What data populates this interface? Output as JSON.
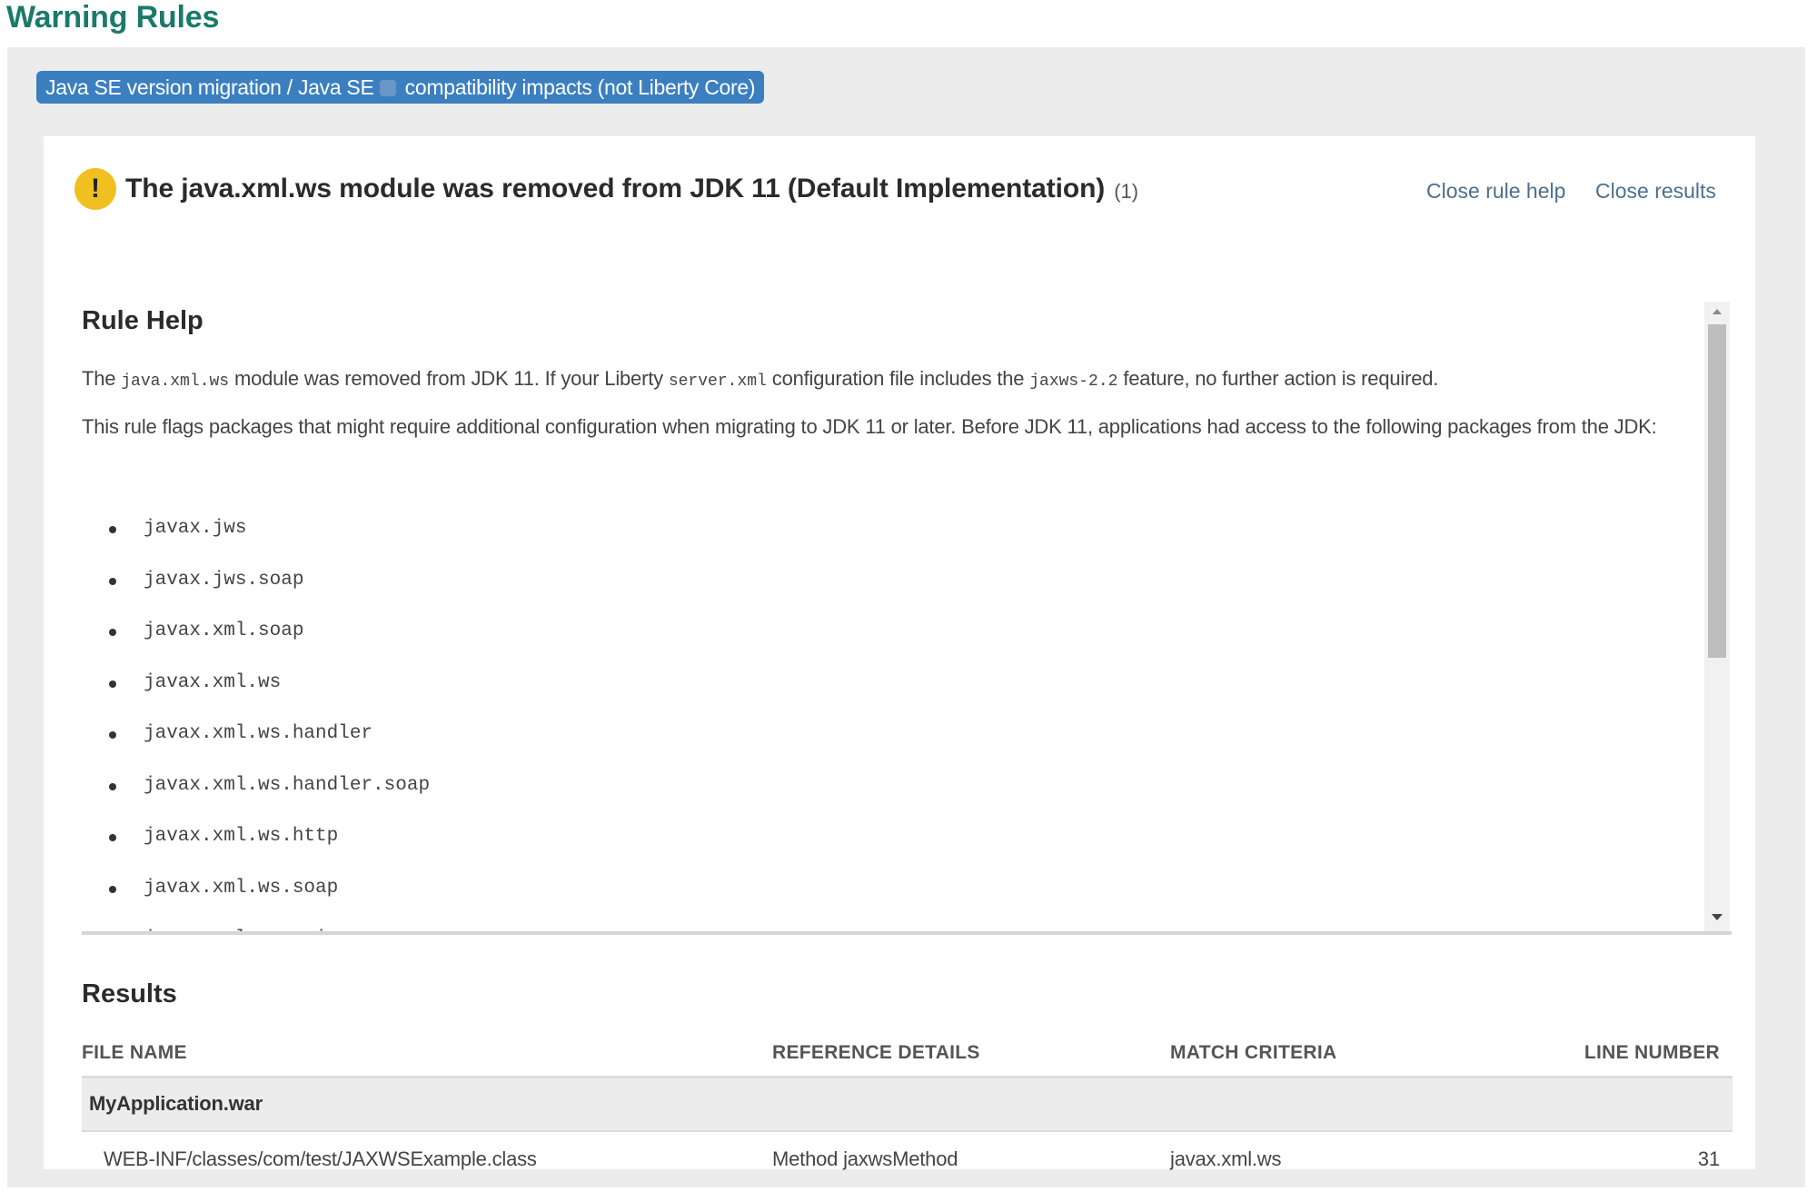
{
  "page": {
    "title": "Warning Rules"
  },
  "category": {
    "label_prefix": "Java SE version migration / Java SE ",
    "label_suffix": " compatibility impacts (not Liberty Core)"
  },
  "rule": {
    "severity_icon": "warning-icon",
    "severity_glyph": "!",
    "title": "The java.xml.ws module was removed from JDK 11 (Default Implementation)",
    "count": "(1)",
    "links": {
      "close_rule_help": "Close rule help",
      "close_results": "Close results"
    }
  },
  "rule_help": {
    "heading": "Rule Help",
    "paragraph1": {
      "t1": "The ",
      "c1": "java.xml.ws",
      "t2": " module was removed from JDK 11. If your Liberty ",
      "c2": "server.xml",
      "t3": " configuration file includes the ",
      "c3": "jaxws-2.2",
      "t4": " feature, no further action is required."
    },
    "paragraph2": "This rule flags packages that might require additional configuration when migrating to JDK 11 or later. Before JDK 11, applications had access to the following packages from the JDK:",
    "packages": [
      "javax.jws",
      "javax.jws.soap",
      "javax.xml.soap",
      "javax.xml.ws",
      "javax.xml.ws.handler",
      "javax.xml.ws.handler.soap",
      "javax.xml.ws.http",
      "javax.xml.ws.soap",
      "javax.xml.ws.spi"
    ],
    "scroll_position_fraction": 0.0
  },
  "results": {
    "heading": "Results",
    "columns": [
      "FILE NAME",
      "REFERENCE DETAILS",
      "MATCH CRITERIA",
      "LINE NUMBER"
    ],
    "groups": [
      {
        "name": "MyApplication.war",
        "rows": [
          {
            "file": "WEB-INF/classes/com/test/JAXWSExample.class",
            "reference": "Method jaxwsMethod",
            "match": "javax.xml.ws",
            "line": "31"
          }
        ]
      }
    ]
  },
  "colors": {
    "title_green": "#1a7a6a",
    "badge_blue": "#3b7fc0",
    "warning_yellow": "#f0c020",
    "link_slate": "#4d6f8e"
  }
}
